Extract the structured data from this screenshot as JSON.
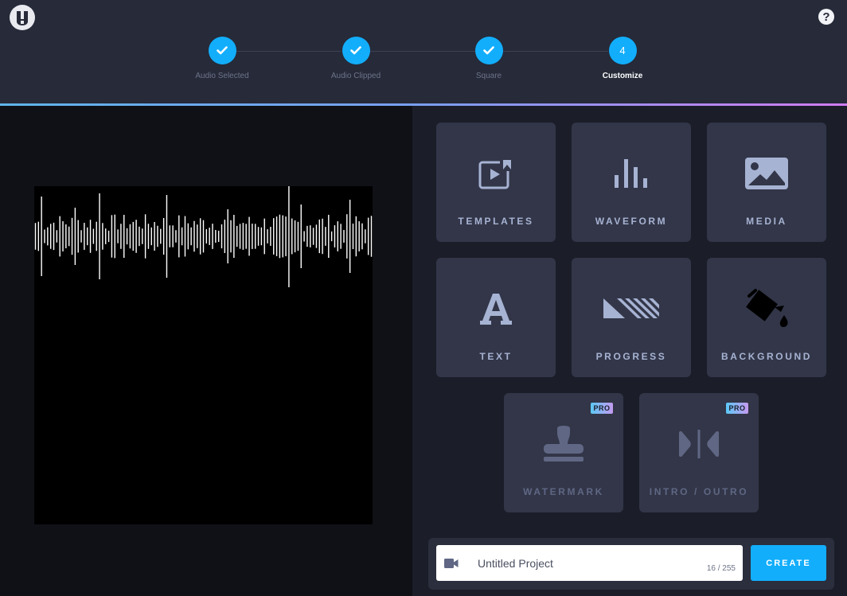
{
  "stepper": {
    "steps": [
      {
        "label": "Audio Selected",
        "state": "done",
        "icon": "check-icon"
      },
      {
        "label": "Audio Clipped",
        "state": "done",
        "icon": "check-icon"
      },
      {
        "label": "Square",
        "state": "done",
        "icon": "check-icon"
      },
      {
        "label": "Customize",
        "state": "active",
        "number": "4"
      }
    ]
  },
  "tiles": [
    {
      "label": "TEMPLATES",
      "icon": "templates-icon"
    },
    {
      "label": "WAVEFORM",
      "icon": "waveform-icon"
    },
    {
      "label": "MEDIA",
      "icon": "image-icon"
    },
    {
      "label": "TEXT",
      "icon": "text-icon"
    },
    {
      "label": "PROGRESS",
      "icon": "progress-icon"
    },
    {
      "label": "BACKGROUND",
      "icon": "paint-bucket-icon"
    },
    {
      "label": "WATERMARK",
      "icon": "stamp-icon",
      "badge": "PRO"
    },
    {
      "label": "INTRO / OUTRO",
      "icon": "intro-outro-icon",
      "badge": "PRO"
    }
  ],
  "project": {
    "name": "Untitled Project",
    "counter": "16 / 255",
    "create_label": "CREATE"
  },
  "colors": {
    "accent": "#12aefc",
    "tile": "#323648",
    "tile_text": "#a7b3d3"
  }
}
